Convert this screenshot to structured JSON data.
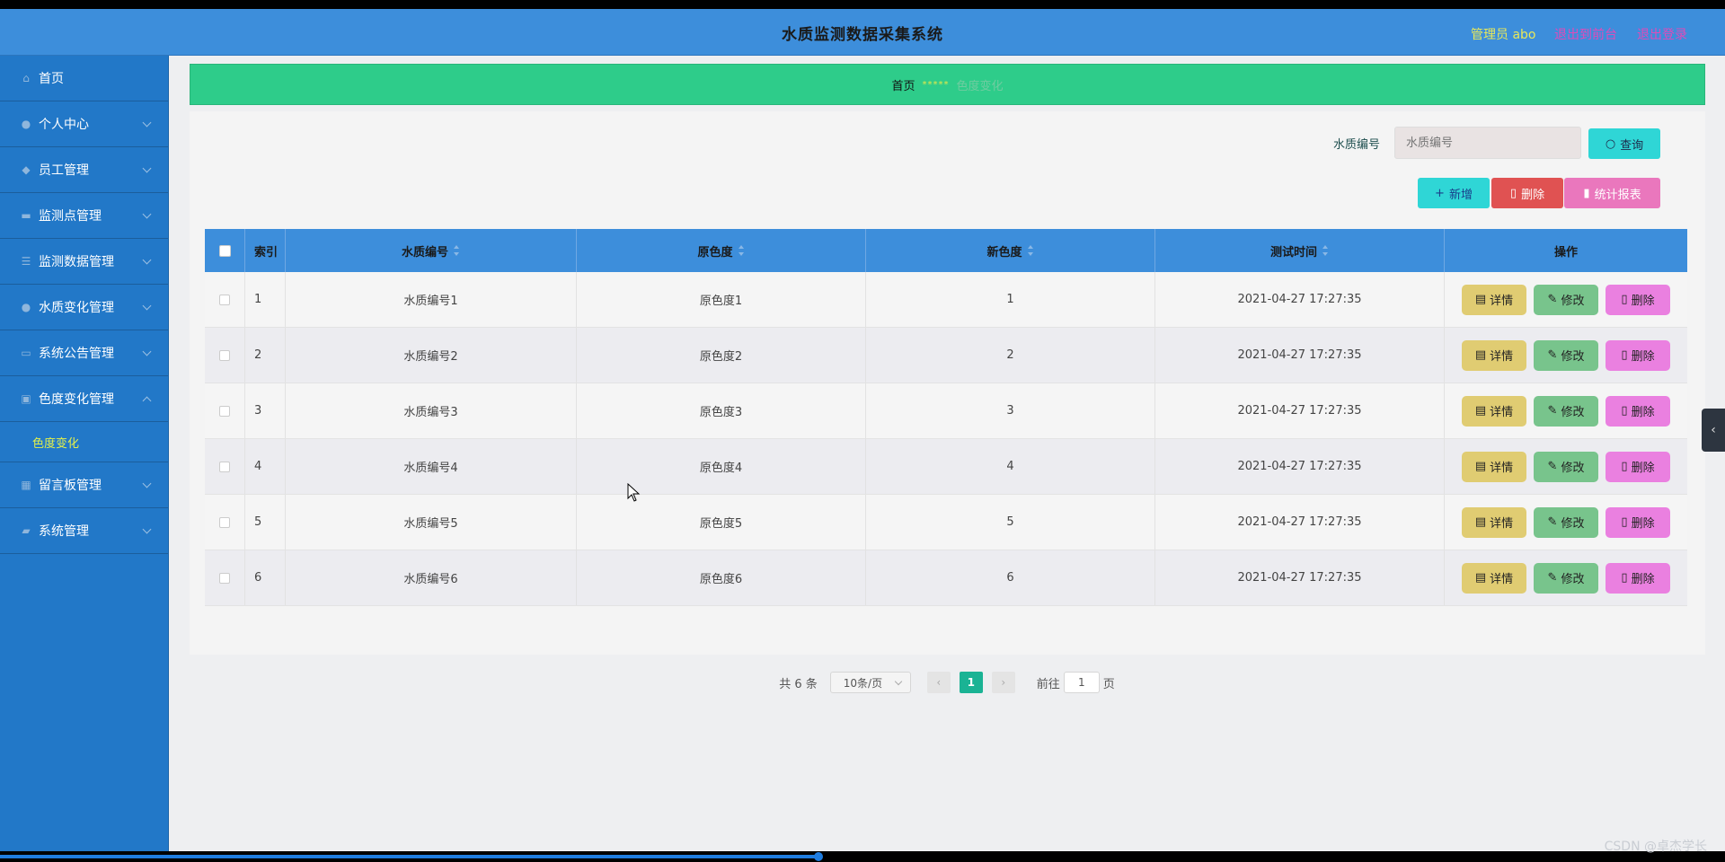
{
  "header": {
    "title": "水质监测数据采集系统",
    "admin": "管理员 abo",
    "to_front": "退出到前台",
    "logout": "退出登录"
  },
  "sidebar": {
    "items": [
      {
        "label": "首页",
        "icon": "home-icon"
      },
      {
        "label": "个人中心",
        "icon": "user-icon"
      },
      {
        "label": "员工管理",
        "icon": "staff-icon"
      },
      {
        "label": "监测点管理",
        "icon": "briefcase-icon"
      },
      {
        "label": "监测数据管理",
        "icon": "list-icon"
      },
      {
        "label": "水质变化管理",
        "icon": "user-icon"
      },
      {
        "label": "系统公告管理",
        "icon": "notice-icon"
      },
      {
        "label": "色度变化管理",
        "icon": "clipboard-icon"
      },
      {
        "label": "留言板管理",
        "icon": "grid-icon"
      },
      {
        "label": "系统管理",
        "icon": "ticket-icon"
      }
    ],
    "active_sub": "色度变化"
  },
  "breadcrumb": {
    "home": "首页",
    "sep": "*****",
    "current": "色度变化"
  },
  "search": {
    "label": "水质编号",
    "placeholder": "水质编号",
    "query_label": "查询"
  },
  "toolbar": {
    "add_label": "新增",
    "delete_label": "删除",
    "stat_label": "统计报表"
  },
  "table": {
    "headers": [
      "索引",
      "水质编号",
      "原色度",
      "新色度",
      "测试时间",
      "操作"
    ],
    "rows": [
      {
        "index": "1",
        "code": "水质编号1",
        "orig": "原色度1",
        "new": "1",
        "time": "2021-04-27 17:27:35"
      },
      {
        "index": "2",
        "code": "水质编号2",
        "orig": "原色度2",
        "new": "2",
        "time": "2021-04-27 17:27:35"
      },
      {
        "index": "3",
        "code": "水质编号3",
        "orig": "原色度3",
        "new": "3",
        "time": "2021-04-27 17:27:35"
      },
      {
        "index": "4",
        "code": "水质编号4",
        "orig": "原色度4",
        "new": "4",
        "time": "2021-04-27 17:27:35"
      },
      {
        "index": "5",
        "code": "水质编号5",
        "orig": "原色度5",
        "new": "5",
        "time": "2021-04-27 17:27:35"
      },
      {
        "index": "6",
        "code": "水质编号6",
        "orig": "原色度6",
        "new": "6",
        "time": "2021-04-27 17:27:35"
      }
    ],
    "ops": {
      "detail": "详情",
      "edit": "修改",
      "delete": "删除"
    }
  },
  "pager": {
    "total": "共 6 条",
    "page_size": "10条/页",
    "current": "1",
    "goto_prefix": "前往",
    "goto_value": "1",
    "goto_suffix": "页"
  },
  "watermark": "CSDN @卓杰学长",
  "colors": {
    "header_bg": "#3d8edb",
    "sidebar_bg": "#2278c8",
    "breadcrumb_bg": "#2ecc8a",
    "accent_teal": "#2fd6d6",
    "danger": "#e05252",
    "pink": "#ea77bd"
  }
}
